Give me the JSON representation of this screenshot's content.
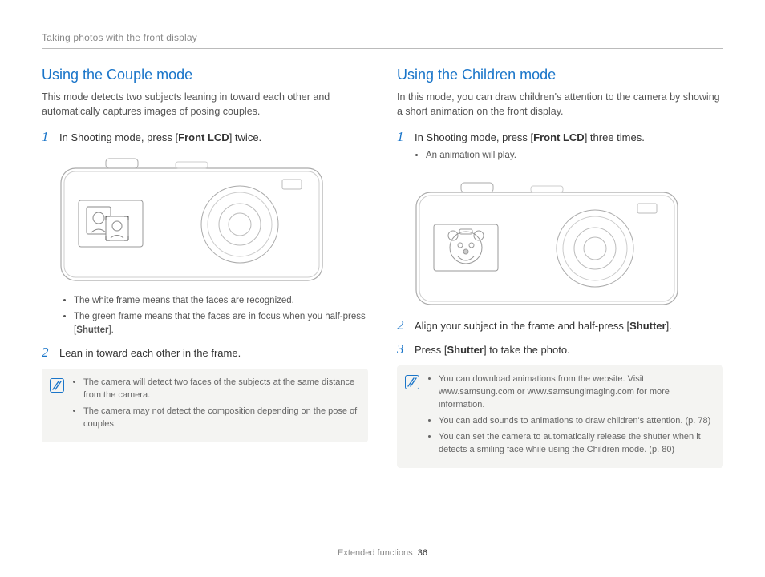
{
  "header": {
    "breadcrumb": "Taking photos with the front display"
  },
  "footer": {
    "section": "Extended functions",
    "page": "36"
  },
  "left": {
    "title": "Using the Couple mode",
    "intro": "This mode detects two subjects leaning in toward each other and automatically captures images of posing couples.",
    "step1_prefix": "In Shooting mode, press [",
    "step1_bold": "Front LCD",
    "step1_suffix": "] twice.",
    "bullet1": "The white frame means that the faces are recognized.",
    "bullet2_prefix": "The green frame means that the faces are in focus when you half-press [",
    "bullet2_bold": "Shutter",
    "bullet2_suffix": "].",
    "step2": "Lean in toward each other in the frame.",
    "note1": "The camera will detect two faces of the subjects at the same distance from the camera.",
    "note2": "The camera may not detect the composition depending on the pose of couples."
  },
  "right": {
    "title": "Using the Children mode",
    "intro": "In this mode, you can draw children's attention to the camera by showing a short animation on the front display.",
    "step1_prefix": "In Shooting mode, press [",
    "step1_bold": "Front LCD",
    "step1_suffix": "] three times.",
    "step1_sub": "An animation will play.",
    "step2_prefix": "Align your subject in the frame and half-press [",
    "step2_bold": "Shutter",
    "step2_suffix": "].",
    "step3_prefix": "Press [",
    "step3_bold": "Shutter",
    "step3_suffix": "] to take the photo.",
    "note1": "You can download animations from the website. Visit www.samsung.com or www.samsungimaging.com for more information.",
    "note2": "You can add sounds to animations to draw children's attention. (p. 78)",
    "note3": "You can set the camera to automatically release the shutter when it detects a smiling face while using the Children mode. (p. 80)"
  },
  "nums": {
    "n1": "1",
    "n2": "2",
    "n3": "3"
  }
}
